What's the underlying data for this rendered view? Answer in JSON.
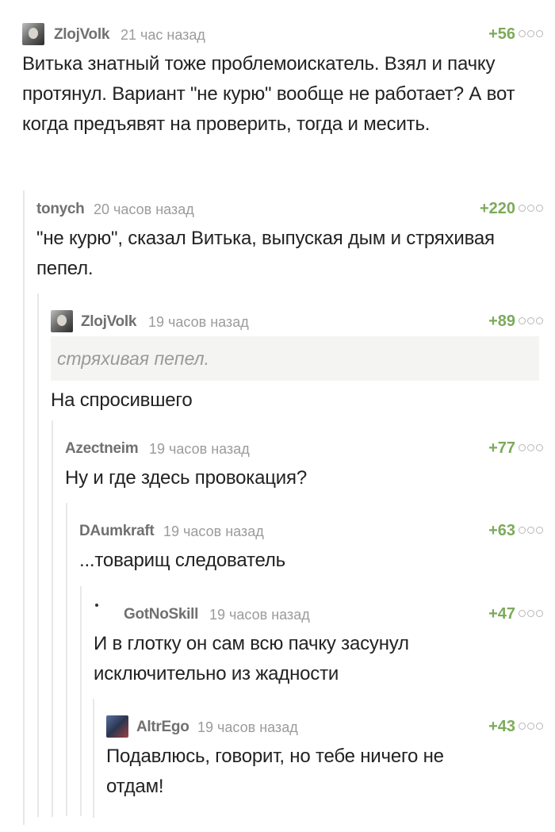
{
  "comments": [
    {
      "user": "ZlojVolk",
      "time": "21 час назад",
      "score": "+56",
      "text": "Витька знатный тоже проблемоискатель. Взял и пачку протянул. Вариант \"не курю\" вообще не работает? А вот когда предъявят на проверить, тогда и месить."
    },
    {
      "user": "tonych",
      "time": "20 часов назад",
      "score": "+220",
      "text": "\"не курю\", сказал Витька, выпуская дым и стряхивая пепел."
    },
    {
      "user": "ZlojVolk",
      "time": "19 часов назад",
      "score": "+89",
      "quote": "стряхивая пепел.",
      "text": "На спросившего"
    },
    {
      "user": "Azectneim",
      "time": "19 часов назад",
      "score": "+77",
      "text": "Ну и где здесь провокация?"
    },
    {
      "user": "DAumkraft",
      "time": "19 часов назад",
      "score": "+63",
      "text": "...товарищ следователь"
    },
    {
      "user": "GotNoSkill",
      "time": "19 часов назад",
      "score": "+47",
      "text": "И в глотку он сам всю пачку засунул исключительно из жадности"
    },
    {
      "user": "AltrEgo",
      "time": "19 часов назад",
      "score": "+43",
      "text": "Подавлюсь, говорит, но тебе ничего не отдам!"
    }
  ],
  "icons": {
    "avatar": "user-avatar-icon",
    "more": "more-options-icon"
  },
  "colors": {
    "score": "#7caa5a",
    "nick": "#707070",
    "time": "#9b9b9b",
    "thread_line": "#e8e8e8",
    "quote_bg": "#f4f4f2"
  }
}
